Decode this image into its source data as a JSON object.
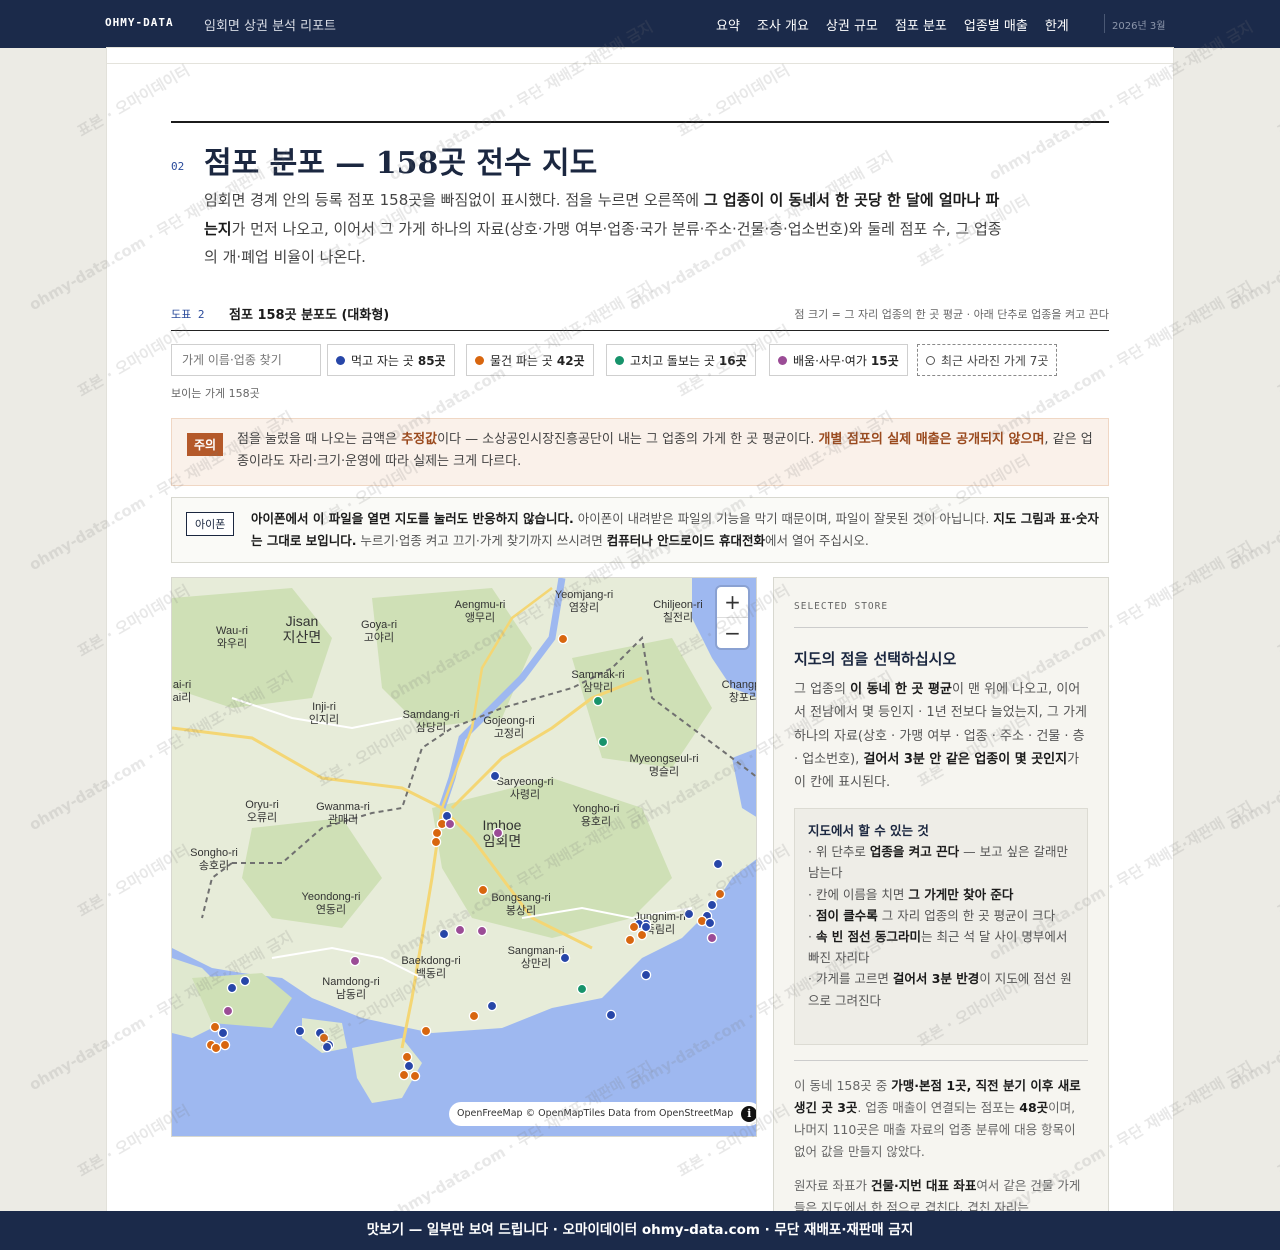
{
  "topbar": {
    "brand": "OHMY-DATA",
    "report_title": "임회면 상권 분석 리포트",
    "nav": [
      "요약",
      "조사 개요",
      "상권 규모",
      "점포 분포",
      "업종별 매출",
      "한계"
    ],
    "date": "2026년 3월"
  },
  "section": {
    "number": "02",
    "title": "점포 분포 — 158곳 전수 지도",
    "intro_1": "임회면 경계 안의 등록 점포 158곳을 빠짐없이 표시했다. 점을 누르면 오른쪽에 ",
    "intro_bold": "그 업종이 이 동네서 한 곳당 한 달에 얼마나 파는지",
    "intro_2": "가 먼저 나오고, 이어서 그 가게 하나의 자료(상호·가맹 여부·업종·국가 분류·주소·건물·층·업소번호)와 둘레 점포 수, 그 업종의 개·폐업 비율이 나온다."
  },
  "figure": {
    "number": "도표 2",
    "title": "점포 158곳 분포도 (대화형)",
    "note": "점 크기 = 그 자리 업종의 한 곳 평균 · 아래 단추로 업종을 켜고 끈다"
  },
  "filters": {
    "search_placeholder": "가게 이름·업종 찾기",
    "chips": [
      {
        "label": "먹고 자는 곳",
        "count": "85곳",
        "color": "#2746a8"
      },
      {
        "label": "물건 파는 곳",
        "count": "42곳",
        "color": "#d8660f"
      },
      {
        "label": "고치고 돌보는 곳",
        "count": "16곳",
        "color": "#17936b"
      },
      {
        "label": "배움·사무·여가",
        "count": "15곳",
        "color": "#9b4c96"
      }
    ],
    "closed_chip": "최근 사라진 가게 7곳",
    "visible_count": "보이는 가게 158곳"
  },
  "caution": {
    "tag": "주의",
    "text_1": "점을 눌렀을 때 나오는 금액은 ",
    "text_bold1": "추정값",
    "text_2": "이다 — 소상공인시장진흥공단이 내는 그 업종의 가게 한 곳 평균이다. ",
    "text_bold2": "개별 점포의 실제 매출은 공개되지 않으며",
    "text_3": ", 같은 업종이라도 자리·크기·운영에 따라 실제는 크게 다르다."
  },
  "iphone_notice": {
    "tag": "아이폰",
    "bold1": "아이폰에서 이 파일을 열면 지도를 눌러도 반응하지 않습니다.",
    "text1": " 아이폰이 내려받은 파일의 기능을 막기 때문이며, 파일이 잘못된 것이 아닙니다. ",
    "bold2": "지도 그림과 표·숫자는 그대로 보입니다.",
    "text2": " 누르기·업종 켜고 끄기·가게 찾기까지 쓰시려면 ",
    "bold3": "컴퓨터나 안드로이드 휴대전화",
    "text3": "에서 열어 주십시오."
  },
  "map": {
    "place_labels": [
      {
        "en": "Yeomjang-ri",
        "ko": "염장리"
      },
      {
        "en": "Aengmu-ri",
        "ko": "앵무리"
      },
      {
        "en": "Chiljeon-ri",
        "ko": "칠전리"
      },
      {
        "en": "Jisan",
        "ko": "지산면"
      },
      {
        "en": "Goya-ri",
        "ko": "고야리"
      },
      {
        "en": "Wau-ri",
        "ko": "와우리"
      },
      {
        "en": "Sammak-ri",
        "ko": "삼막리"
      },
      {
        "en": "Changpo",
        "ko": "창포리"
      },
      {
        "en": "Inji-ri",
        "ko": "인지리"
      },
      {
        "en": "Samdang-ri",
        "ko": "삼당리"
      },
      {
        "en": "Gojeong-ri",
        "ko": "고정리"
      },
      {
        "en": "Myeongseul-ri",
        "ko": "명슬리"
      },
      {
        "en": "Saryeong-ri",
        "ko": "사령리"
      },
      {
        "en": "Oryu-ri",
        "ko": "오류리"
      },
      {
        "en": "Gwanma-ri",
        "ko": "관매리"
      },
      {
        "en": "Yongho-ri",
        "ko": "용호리"
      },
      {
        "en": "Imhoe",
        "ko": "임회면"
      },
      {
        "en": "Songho-ri",
        "ko": "송호리"
      },
      {
        "en": "Yeondong-ri",
        "ko": "연동리"
      },
      {
        "en": "Bongsang-ri",
        "ko": "봉상리"
      },
      {
        "en": "Jungnim-ri",
        "ko": "죽림리"
      },
      {
        "en": "Sangman-ri",
        "ko": "상만리"
      },
      {
        "en": "Baekdong-ri",
        "ko": "백동리"
      },
      {
        "en": "Namdong-ri",
        "ko": "남동리"
      },
      {
        "en": "ai-ri",
        "ko": "ai리"
      }
    ],
    "zoom_in": "+",
    "zoom_out": "−",
    "attribution": "OpenFreeMap © OpenMapTiles Data from OpenStreetMap",
    "info_icon": "i"
  },
  "side": {
    "eyebrow": "SELECTED STORE",
    "title": "지도의 점을 선택하십시오",
    "desc_1": "그 업종의 ",
    "desc_b1": "이 동네 한 곳 평균",
    "desc_2": "이 맨 위에 나오고, 이어서 전남에서 몇 등인지 · 1년 전보다 늘었는지, 그 가게 하나의 자료(상호 · 가맹 여부 · 업종 · 주소 · 건물 · 층 · 업소번호), ",
    "desc_b2": "걸어서 3분 안 같은 업종이 몇 곳인지",
    "desc_3": "가 이 칸에 표시된다.",
    "help_title": "지도에서 할 수 있는 것",
    "help_items": [
      {
        "pre": "· 위 단추로 ",
        "b": "업종을 켜고 끈다",
        "post": " — 보고 싶은 갈래만 남는다"
      },
      {
        "pre": "· 칸에 이름을 치면 ",
        "b": "그 가게만 찾아 준다",
        "post": ""
      },
      {
        "pre": "· ",
        "b": "점이 클수록",
        "post": " 그 자리 업종의 한 곳 평균이 크다"
      },
      {
        "pre": "· ",
        "b": "속 빈 점선 동그라미",
        "post": "는 최근 석 달 사이 명부에서 빠진 자리다"
      },
      {
        "pre": "· 가게를 고르면 ",
        "b": "걸어서 3분 반경",
        "post": "이 지도에 점선 원으로 그려진다"
      }
    ],
    "para1_1": "이 동네 158곳 중 ",
    "para1_b1": "가맹·본점 1곳, 직전 분기 이후 새로 생긴 곳 3곳",
    "para1_2": ". 업종 매출이 연결되는 점포는 ",
    "para1_b2": "48곳",
    "para1_3": "이며, 나머지 110곳은 매출 자료의 업종 분류에 대응 항목이 없어 값을 만들지 않았다.",
    "para2_1": "원자료 좌표가 ",
    "para2_b1": "건물·지번 대표 좌표",
    "para2_2": "여서 같은 건물 가게들은 지도에서 한 점으로 겹친다. 겹친 자리는"
  },
  "watermark": "표본 · 오마이데이터",
  "watermark2": "ohmy-data.com · 무단 재배포·재판매 금지",
  "banner": "맛보기 — 일부만 보여 드립니다 · 오마이데이터 ohmy-data.com · 무단 재배포·재판매 금지"
}
